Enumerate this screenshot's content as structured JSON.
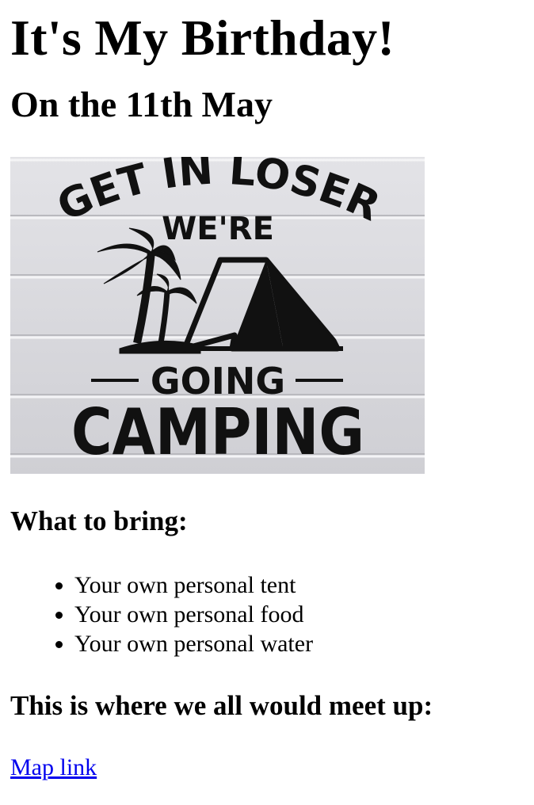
{
  "page": {
    "title": "It's My Birthday!",
    "date_heading": "On the 11th May",
    "poster": {
      "line1": "GET IN LOSER",
      "line2": "WE'RE",
      "line3": "GOING",
      "line4": "CAMPING"
    },
    "bring_heading": "What to bring:",
    "bring_items": [
      "Your own personal tent",
      "Your own personal food",
      "Your own personal water"
    ],
    "meet_heading": "This is where we all would meet up:",
    "map_link_label": "Map link"
  },
  "colors": {
    "link": "#0000ee",
    "poster_background": "#d9d9dd",
    "poster_ink": "#111111"
  }
}
